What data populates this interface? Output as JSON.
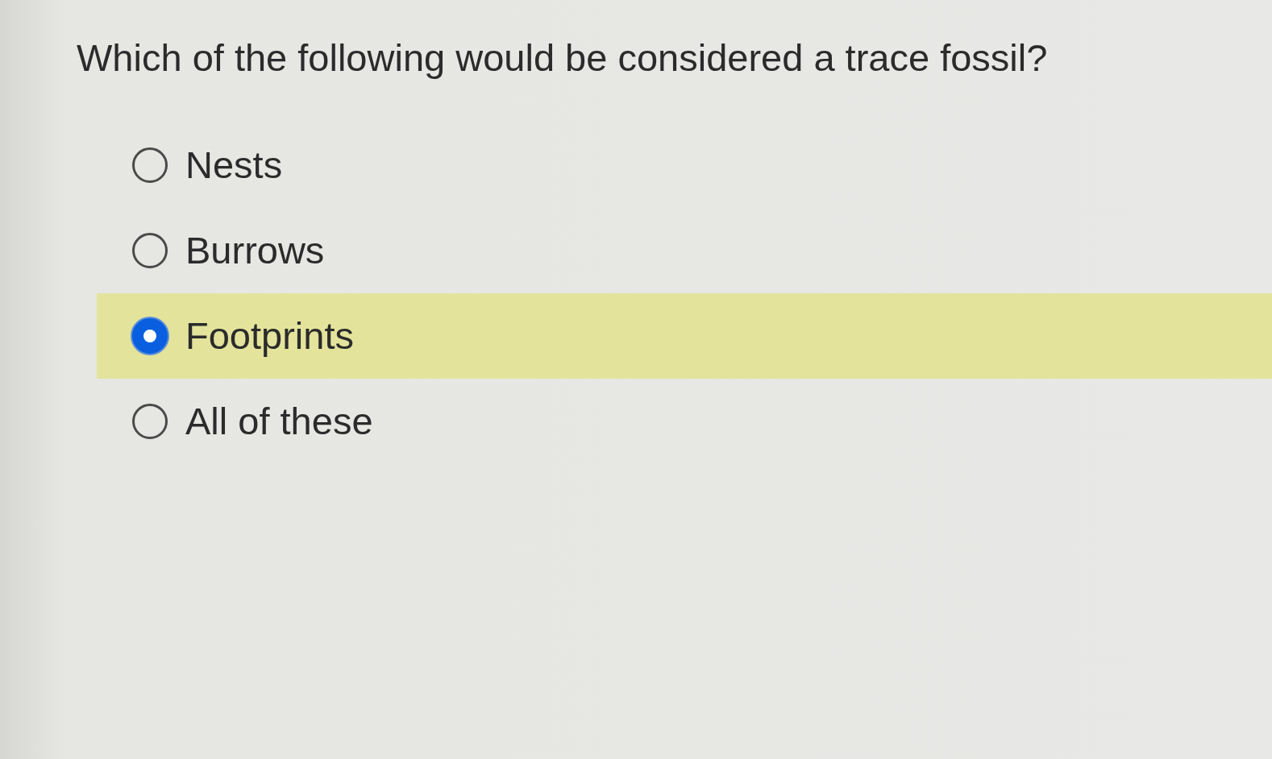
{
  "question": "Which of the following would be considered a trace fossil?",
  "options": [
    {
      "label": "Nests",
      "selected": false
    },
    {
      "label": "Burrows",
      "selected": false
    },
    {
      "label": "Footprints",
      "selected": true
    },
    {
      "label": "All of these",
      "selected": false
    }
  ]
}
